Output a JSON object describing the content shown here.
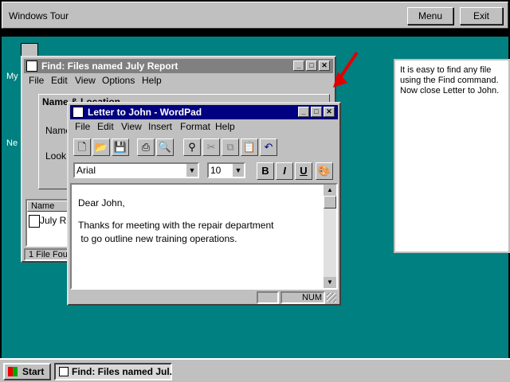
{
  "tour_bar": {
    "title": "Windows Tour",
    "menu_label": "Menu",
    "exit_label": "Exit"
  },
  "desktop": {
    "frag_my": "My",
    "frag_ne": "Ne"
  },
  "find_window": {
    "title": "Find: Files named July Report",
    "menu": [
      "File",
      "Edit",
      "View",
      "Options",
      "Help"
    ],
    "tab_label": "Name & Location",
    "name_label": "Name",
    "look_label": "Look",
    "col_name": "Name",
    "result_item": "July Re",
    "status": "1 File Four"
  },
  "wordpad": {
    "title": "Letter to John - WordPad",
    "menu": [
      "File",
      "Edit",
      "View",
      "Insert",
      "Format",
      "Help"
    ],
    "font": "Arial",
    "size": "10",
    "bold": "B",
    "italic": "I",
    "underline": "U",
    "body_line1": "Dear John,",
    "body_line2": "Thanks for meeting with the repair department",
    "body_line3": " to go outline new training operations.",
    "status_num": "NUM"
  },
  "help_panel": {
    "text": "It is easy to find any file using the Find command. Now close Letter to John."
  },
  "taskbar": {
    "start_label": "Start",
    "task_label": "Find: Files named Jul."
  },
  "colors": {
    "desktop": "#008080",
    "active_title": "#000080",
    "inactive_title": "#808080",
    "arrow": "#e00000"
  }
}
